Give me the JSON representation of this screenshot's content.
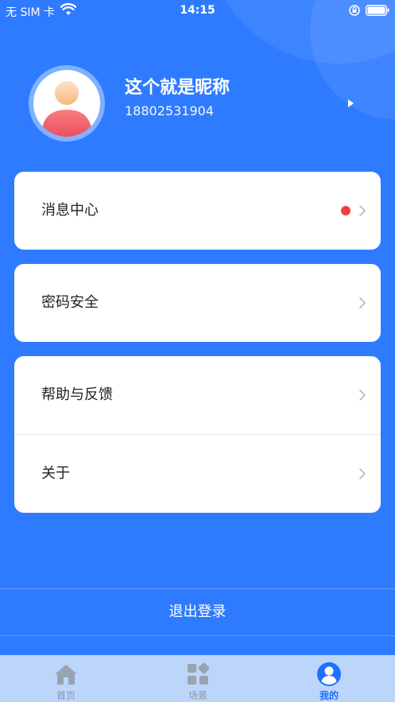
{
  "status_bar": {
    "carrier": "无 SIM 卡",
    "time": "14:15"
  },
  "profile": {
    "nickname": "这个就是昵称",
    "phone": "18802531904"
  },
  "menu": {
    "message_center": "消息中心",
    "password_security": "密码安全",
    "help_feedback": "帮助与反馈",
    "about": "关于"
  },
  "logout_label": "退出登录",
  "tabs": [
    {
      "label": "首页",
      "icon": "home-icon"
    },
    {
      "label": "场景",
      "icon": "grid-icon"
    },
    {
      "label": "我的",
      "icon": "user-icon",
      "active": true
    }
  ],
  "colors": {
    "primary": "#2f7bff",
    "tab_active": "#1f6fff",
    "badge": "#f2403b",
    "tabbar": "#bcd6fb"
  }
}
